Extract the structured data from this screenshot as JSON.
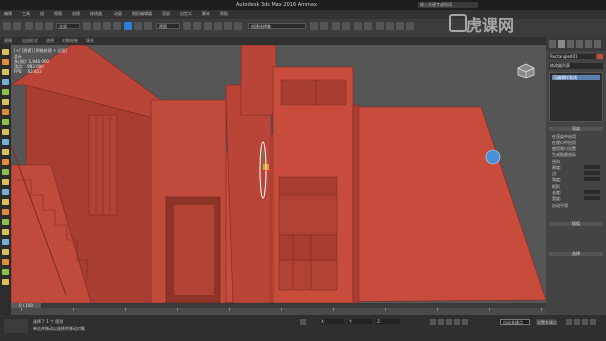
{
  "titlebar": {
    "title": "Autodesk 3ds Max 2016    Ammax",
    "search_placeholder": "键入关键字或短语"
  },
  "menubar": {
    "items": [
      "编辑",
      "工具",
      "组",
      "视图",
      "创建",
      "修改器",
      "动画",
      "图形编辑器",
      "渲染",
      "自定义",
      "脚本",
      "帮助"
    ]
  },
  "toolbar": {
    "filter_value": "全部",
    "view_value": "视图",
    "selection_set": "创建选择集"
  },
  "ribbon": {
    "labels": [
      "建模",
      "自由形式",
      "选择",
      "对象绘制",
      "填充"
    ],
    "sub_label": "多边形建模"
  },
  "viewport": {
    "label": "[+] [透视] [明暗处理 + 边面]",
    "stats": "总计\n多边形: 1,946 000\n顶点:   983 000\nFPS:    62.853"
  },
  "right_panel": {
    "object_name": "Rectangle001",
    "modifier_list": "修改器列表",
    "stack_item": "可编辑样条线",
    "rollout_1": "渲染",
    "rows": [
      "在渲染中启用",
      "在视口中启用",
      "使用视口设置",
      "生成贴图坐标",
      "径向",
      "厚度:",
      "边:",
      "角度:",
      "矩形",
      "长度:",
      "宽度:",
      "自动平滑"
    ],
    "rollout_2": "插值",
    "rollout_3": "选择"
  },
  "timeline": {
    "frame_readout": "0 / 100",
    "ticks": [
      "0",
      "10",
      "20",
      "30",
      "40",
      "50",
      "60",
      "70",
      "80",
      "90",
      "100"
    ]
  },
  "statusbar": {
    "line1": "选择了 1 个 图形",
    "line2": "单击并拖动以选择并移动对象",
    "x_label": "X:",
    "y_label": "Y:",
    "z_label": "Z:",
    "autokey": "自动关键点",
    "set_key": "设置关键点"
  },
  "watermark": {
    "text": "虎课网"
  },
  "colors": {
    "model": "#c74c3c",
    "model_dark": "#8e3328",
    "viewport_bg": "#565656",
    "gizmo": "#2d7fd6"
  }
}
